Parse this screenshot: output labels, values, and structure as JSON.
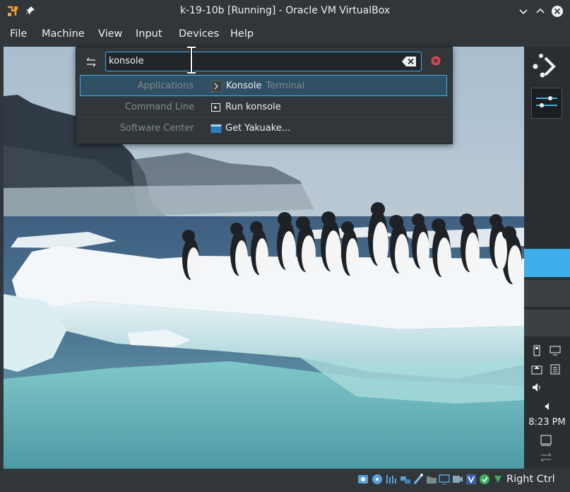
{
  "window": {
    "title": "k-19-10b [Running] - Oracle VM VirtualBox"
  },
  "menubar": {
    "items": [
      "File",
      "Machine",
      "View",
      "Input",
      "Devices",
      "Help"
    ]
  },
  "krunner": {
    "query": "konsole",
    "results": [
      {
        "category": "Applications",
        "label": "Konsole",
        "sublabel": "Terminal",
        "icon": "konsole-app-icon",
        "selected": true
      },
      {
        "category": "Command Line",
        "label": "Run konsole",
        "sublabel": "",
        "icon": "run-command-icon",
        "selected": false
      },
      {
        "category": "Software Center",
        "label": "Get Yakuake...",
        "sublabel": "",
        "icon": "software-center-icon",
        "selected": false
      }
    ]
  },
  "panel": {
    "clock": "8:23 PM",
    "accent": "#3daee9"
  },
  "statusbar": {
    "host_key": "Right Ctrl",
    "icons": [
      "hard-disk-icon",
      "optical-drive-icon",
      "audio-icon",
      "network-icon",
      "usb-icon",
      "shared-folder-icon",
      "display-icon",
      "recording-icon",
      "vt-x-icon",
      "mouse-integration-icon",
      "keyboard-capture-icon"
    ]
  },
  "colors": {
    "window_bg": "#31363b",
    "accent": "#3daee9",
    "text": "#eff0f1",
    "muted": "#7f8c8d",
    "clear_red": "#da4453"
  }
}
